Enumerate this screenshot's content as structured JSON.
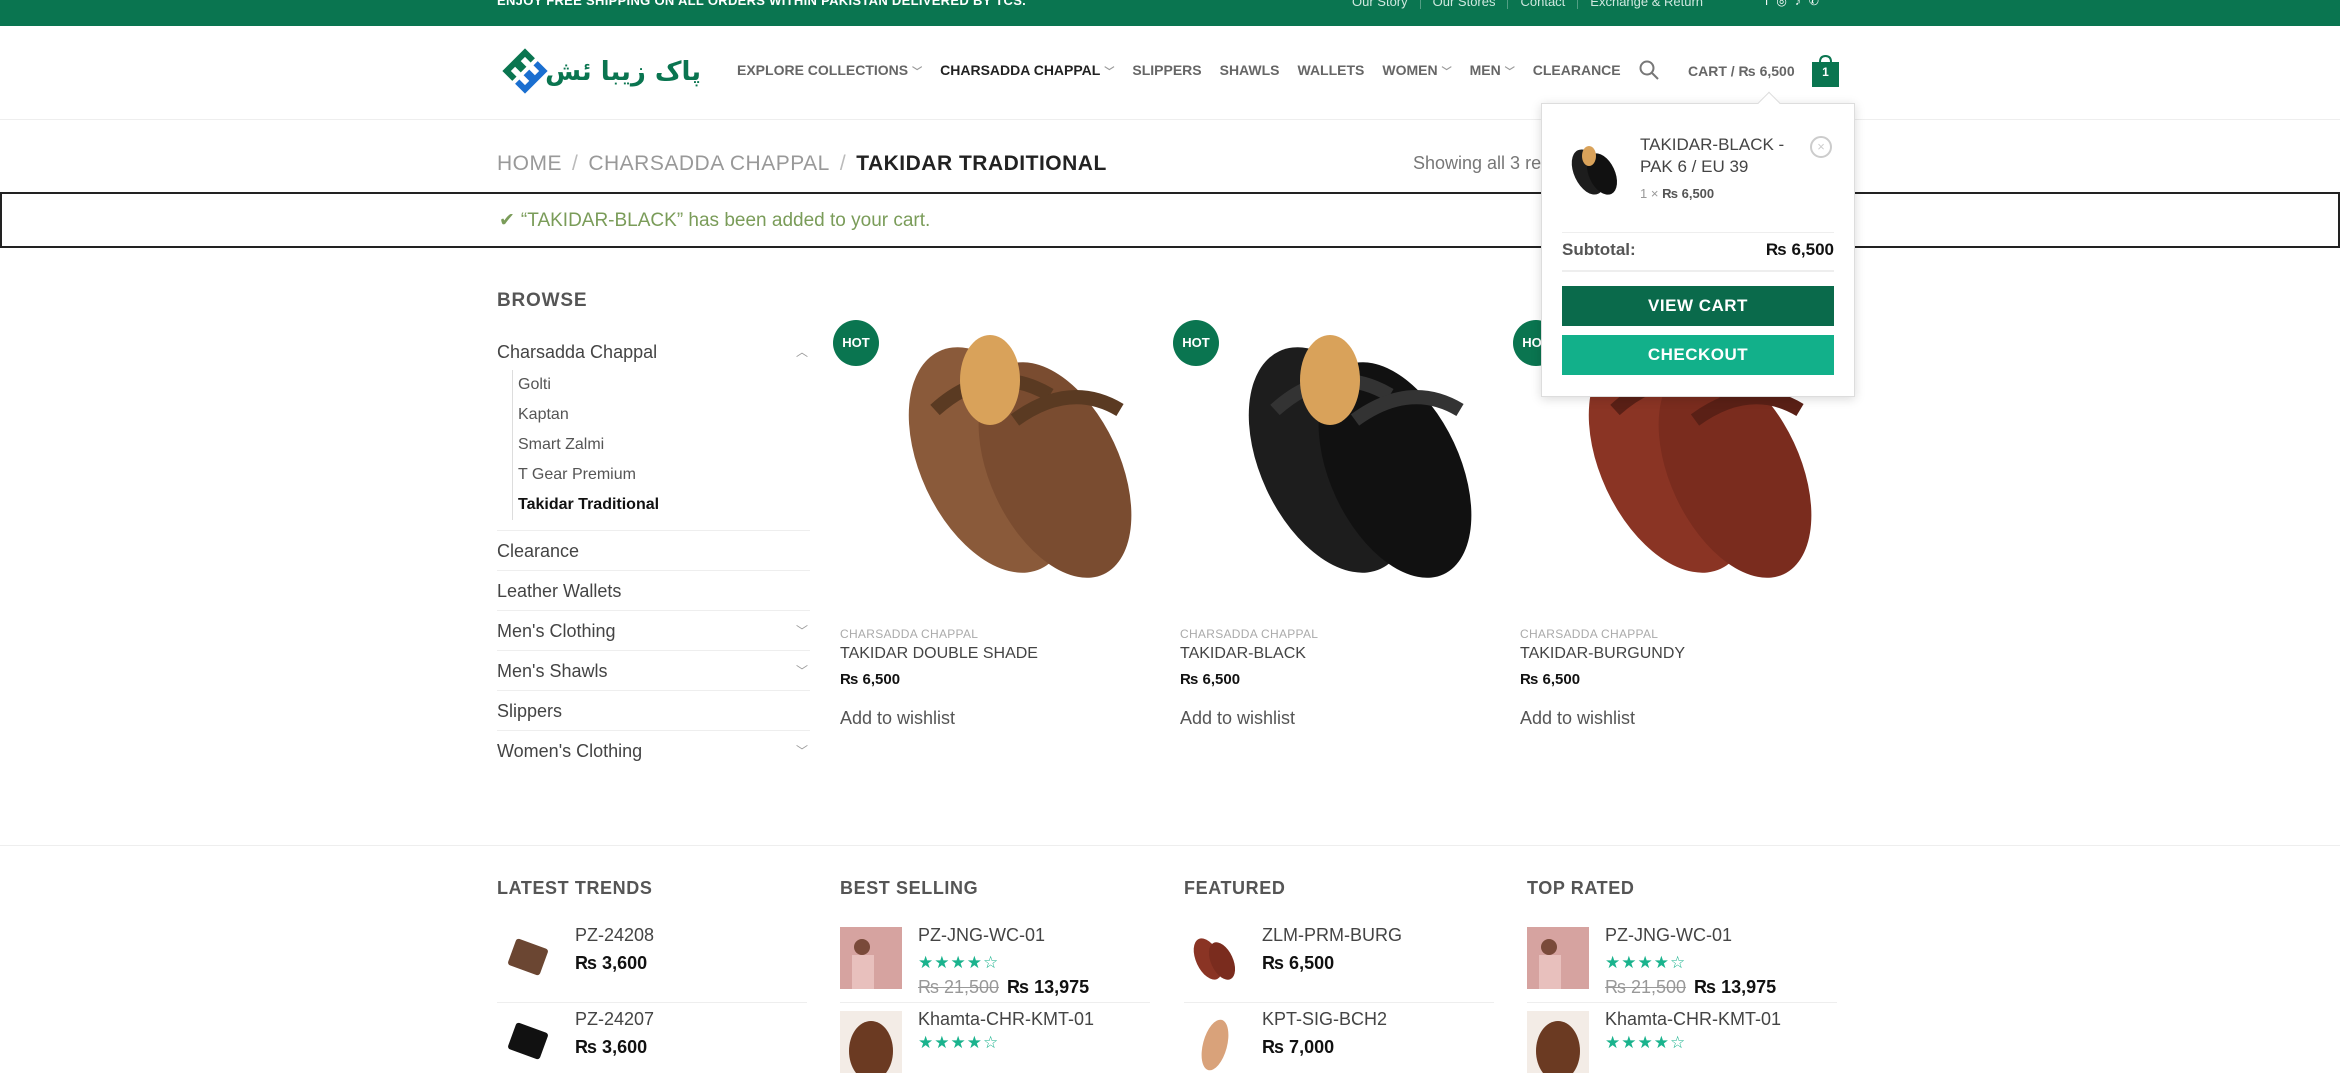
{
  "topbar": {
    "promo": "ENJOY FREE SHIPPING ON ALL ORDERS WITHIN PAKISTAN DELIVERED BY TCS.",
    "links": [
      "Our Story",
      "Our Stores",
      "Contact",
      "Exchange & Return"
    ],
    "social_icons": [
      "facebook-icon",
      "instagram-icon",
      "tiktok-icon",
      "phone-icon"
    ]
  },
  "header": {
    "logo_text": "پاک زیبا ئش",
    "nav": [
      {
        "label": "EXPLORE COLLECTIONS",
        "dropdown": true
      },
      {
        "label": "CHARSADDA CHAPPAL",
        "dropdown": true,
        "active": true
      },
      {
        "label": "SLIPPERS",
        "dropdown": false
      },
      {
        "label": "SHAWLS",
        "dropdown": false
      },
      {
        "label": "WALLETS",
        "dropdown": false
      },
      {
        "label": "WOMEN",
        "dropdown": true
      },
      {
        "label": "MEN",
        "dropdown": true
      },
      {
        "label": "CLEARANCE",
        "dropdown": false
      }
    ],
    "cart_label": "CART / ₨ 6,500",
    "cart_count": "1"
  },
  "breadcrumb": {
    "items": [
      "HOME",
      "CHARSADDA CHAPPAL"
    ],
    "current": "TAKIDAR TRADITIONAL"
  },
  "showing": "Showing all 3 re",
  "notice": {
    "text": "“TAKIDAR-BLACK” has been added to your cart."
  },
  "sidebar": {
    "title": "BROWSE",
    "parent": "Charsadda Chappal",
    "sub": [
      "Golti",
      "Kaptan",
      "Smart Zalmi",
      "T Gear Premium"
    ],
    "sub_current": "Takidar Traditional",
    "others": [
      {
        "label": "Clearance",
        "toggle": false
      },
      {
        "label": "Leather Wallets",
        "toggle": false
      },
      {
        "label": "Men's Clothing",
        "toggle": true
      },
      {
        "label": "Men's Shawls",
        "toggle": true
      },
      {
        "label": "Slippers",
        "toggle": false
      },
      {
        "label": "Women's Clothing",
        "toggle": true
      }
    ]
  },
  "products": [
    {
      "badge": "HOT",
      "category": "CHARSADDA CHAPPAL",
      "name": "TAKIDAR DOUBLE SHADE",
      "price": "₨ 6,500",
      "wishlist": "Add to wishlist",
      "color": "#8a5a3a"
    },
    {
      "badge": "HOT",
      "category": "CHARSADDA CHAPPAL",
      "name": "TAKIDAR-BLACK",
      "price": "₨ 6,500",
      "wishlist": "Add to wishlist",
      "color": "#1d1d1d"
    },
    {
      "badge": "HOT",
      "category": "CHARSADDA CHAPPAL",
      "name": "TAKIDAR-BURGUNDY",
      "price": "₨ 6,500",
      "wishlist": "Add to wishlist",
      "color": "#8a3424"
    }
  ],
  "cart_popup": {
    "item_name": "TAKIDAR-BLACK - PAK 6 / EU 39",
    "qty": "1 ×",
    "item_price": "₨ 6,500",
    "subtotal_label": "Subtotal:",
    "subtotal_value": "₨ 6,500",
    "view_cart": "VIEW CART",
    "checkout": "CHECKOUT"
  },
  "footer": [
    {
      "title": "LATEST TRENDS",
      "items": [
        {
          "name": "PZ-24208",
          "price": "₨ 3,600",
          "thumb": "wallet-brown"
        },
        {
          "name": "PZ-24207",
          "price": "₨ 3,600",
          "thumb": "wallet-black"
        }
      ]
    },
    {
      "title": "BEST SELLING",
      "items": [
        {
          "name": "PZ-JNG-WC-01",
          "stars": "★★★★☆",
          "old": "₨ 21,500",
          "price": "₨ 13,975",
          "thumb": "clothing-pink"
        },
        {
          "name": "Khamta-CHR-KMT-01",
          "stars": "★★★★☆",
          "thumb": "chappal-brown"
        }
      ]
    },
    {
      "title": "FEATURED",
      "items": [
        {
          "name": "ZLM-PRM-BURG",
          "price": "₨ 6,500",
          "thumb": "chappal-burgundy"
        },
        {
          "name": "KPT-SIG-BCH2",
          "price": "₨ 7,000",
          "thumb": "chappal-tan"
        }
      ]
    },
    {
      "title": "TOP RATED",
      "items": [
        {
          "name": "PZ-JNG-WC-01",
          "stars": "★★★★☆",
          "old": "₨ 21,500",
          "price": "₨ 13,975",
          "thumb": "clothing-pink"
        },
        {
          "name": "Khamta-CHR-KMT-01",
          "stars": "★★★★☆",
          "thumb": "chappal-brown"
        }
      ]
    }
  ]
}
